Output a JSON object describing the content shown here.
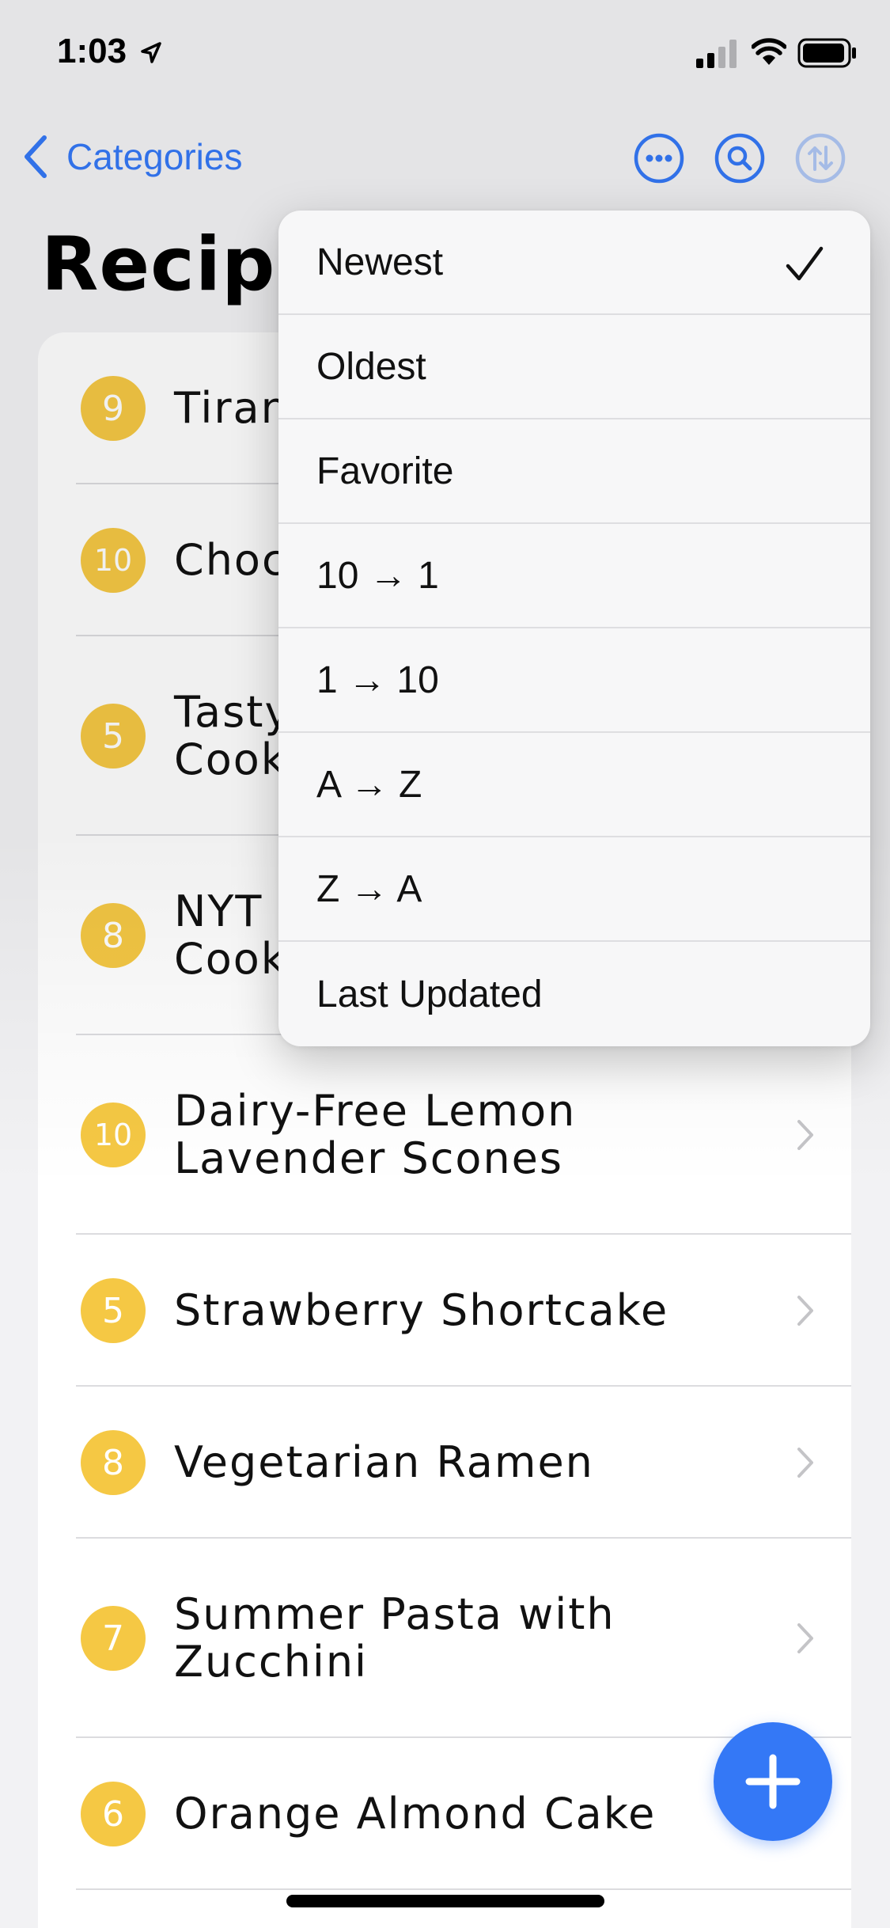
{
  "status_bar": {
    "time": "1:03",
    "icons": [
      "location-arrow-icon",
      "cellular-signal-icon",
      "wifi-icon",
      "battery-icon"
    ]
  },
  "nav": {
    "back_label": "Categories",
    "back_icon": "chevron-left-icon",
    "actions": [
      "ellipsis-circle-icon",
      "search-circle-icon",
      "sort-arrows-icon"
    ]
  },
  "page": {
    "title": "Recipe"
  },
  "colors": {
    "accent": "#3478f6",
    "badge": "#f5c844",
    "background": "#f2f2f4"
  },
  "sort_menu": {
    "selected": "Newest",
    "options": [
      {
        "label": "Newest",
        "checked": true
      },
      {
        "label": "Oldest",
        "checked": false
      },
      {
        "label": "Favorite",
        "checked": false
      },
      {
        "label": "10 → 1",
        "checked": false
      },
      {
        "label": "1 → 10",
        "checked": false
      },
      {
        "label": "A → Z",
        "checked": false
      },
      {
        "label": "Z → A",
        "checked": false
      },
      {
        "label": "Last Updated",
        "checked": false
      }
    ]
  },
  "recipes": [
    {
      "rating": "9",
      "title": "Tiran"
    },
    {
      "rating": "10",
      "title": "Choc"
    },
    {
      "rating": "5",
      "title": "Tasty\nCook"
    },
    {
      "rating": "8",
      "title": "NYT\nCook"
    },
    {
      "rating": "10",
      "title": "Dairy-Free Lemon\nLavender Scones"
    },
    {
      "rating": "5",
      "title": "Strawberry Shortcake"
    },
    {
      "rating": "8",
      "title": "Vegetarian Ramen"
    },
    {
      "rating": "7",
      "title": "Summer Pasta with\nZucchini"
    },
    {
      "rating": "6",
      "title": "Orange Almond Cake"
    }
  ],
  "fab": {
    "icon": "plus-icon"
  }
}
